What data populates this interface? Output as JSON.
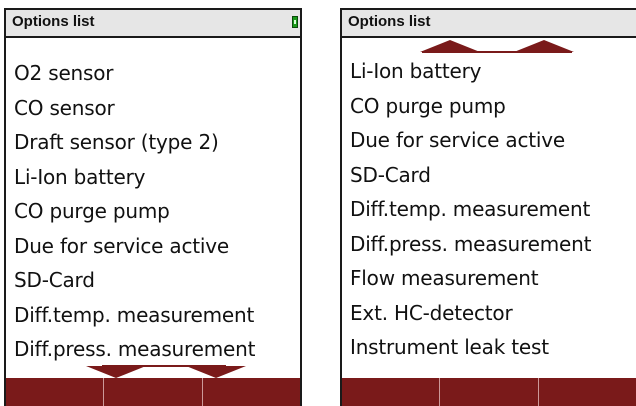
{
  "screens": [
    {
      "title": "Options list",
      "items": [
        "O2 sensor",
        "CO sensor",
        "Draft sensor (type 2)",
        "Li-Ion battery",
        "CO purge pump",
        "Due for service active",
        "SD-Card",
        "Diff.temp. measurement",
        "Diff.press. measurement"
      ],
      "scroll_indicator": "down-arrow-icon"
    },
    {
      "title": "Options list",
      "items": [
        "Li-Ion battery",
        "CO purge pump",
        "Due for service active",
        "SD-Card",
        "Diff.temp. measurement",
        "Diff.press. measurement",
        "Flow measurement",
        "Ext. HC-detector",
        "Instrument leak test"
      ],
      "scroll_indicator": "up-arrow-icon"
    }
  ],
  "colors": {
    "softkey_bar": "#7a1a1a",
    "title_bar": "#e6e6e6",
    "battery_fill": "#22cc22"
  }
}
